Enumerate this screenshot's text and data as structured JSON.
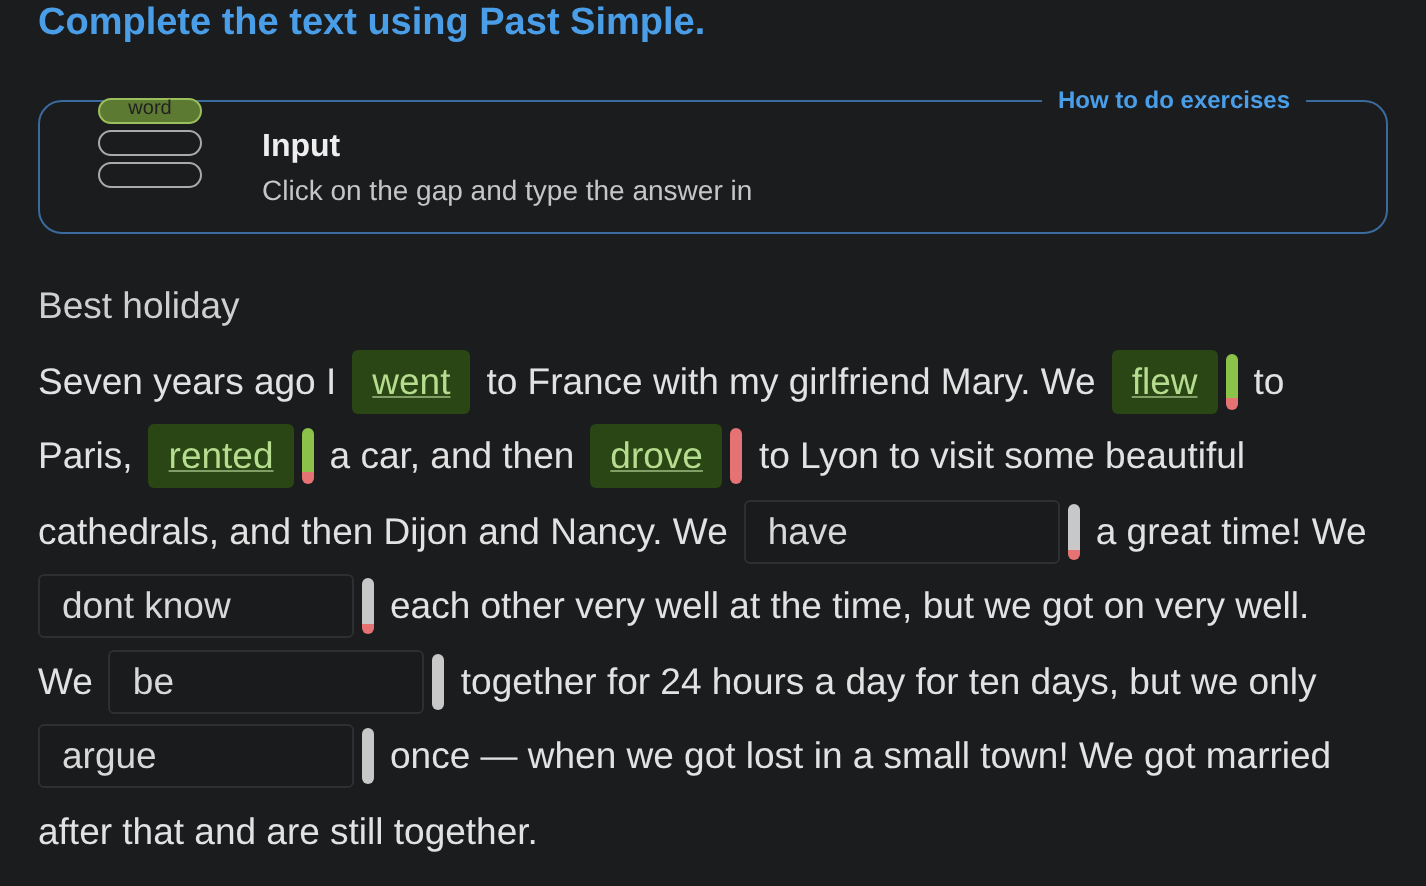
{
  "title": "Complete the text using Past Simple.",
  "instructions": {
    "link": "How to do exercises",
    "heading": "Input",
    "text": "Click on the gap and type the answer in",
    "icon_word": "word"
  },
  "section_title": "Best holiday",
  "lines": [
    [
      {
        "kind": "text",
        "text": "Seven years ago I"
      },
      {
        "kind": "gap",
        "filled": true,
        "value": "went"
      },
      {
        "kind": "text",
        "text": "to France with my girlfriend Mary. We"
      },
      {
        "kind": "gap",
        "filled": true,
        "value": "flew",
        "indicator": {
          "kind": "correct_after_error"
        }
      },
      {
        "kind": "text",
        "text": "to"
      }
    ],
    [
      {
        "kind": "text",
        "text": "Paris,"
      },
      {
        "kind": "gap",
        "filled": true,
        "value": "rented",
        "indicator": {
          "kind": "correct_after_error"
        }
      },
      {
        "kind": "text",
        "text": "a car, and then"
      },
      {
        "kind": "gap",
        "filled": true,
        "value": "drove",
        "indicator": {
          "kind": "wrong"
        }
      },
      {
        "kind": "text",
        "text": "to Lyon to visit some beautiful"
      }
    ],
    [
      {
        "kind": "text",
        "text": "cathedrals, and then Dijon and Nancy. We"
      },
      {
        "kind": "gap",
        "filled": false,
        "value": "have",
        "indicator": {
          "kind": "pending_after_error"
        }
      },
      {
        "kind": "text",
        "text": "a great time! We"
      }
    ],
    [
      {
        "kind": "gap",
        "filled": false,
        "value": "dont know",
        "indicator": {
          "kind": "pending_after_error"
        }
      },
      {
        "kind": "text",
        "text": "each other very well at the time, but we got on very well."
      }
    ],
    [
      {
        "kind": "text",
        "text": "We"
      },
      {
        "kind": "gap",
        "filled": false,
        "value": "be",
        "indicator": {
          "kind": "pending"
        }
      },
      {
        "kind": "text",
        "text": "together for 24 hours a day for ten days, but we only"
      }
    ],
    [
      {
        "kind": "gap",
        "filled": false,
        "value": "argue",
        "indicator": {
          "kind": "pending"
        }
      },
      {
        "kind": "text",
        "text": "once — when we got lost in a small town! We got married"
      }
    ],
    [
      {
        "kind": "text",
        "text": "after that and are still together."
      }
    ]
  ]
}
